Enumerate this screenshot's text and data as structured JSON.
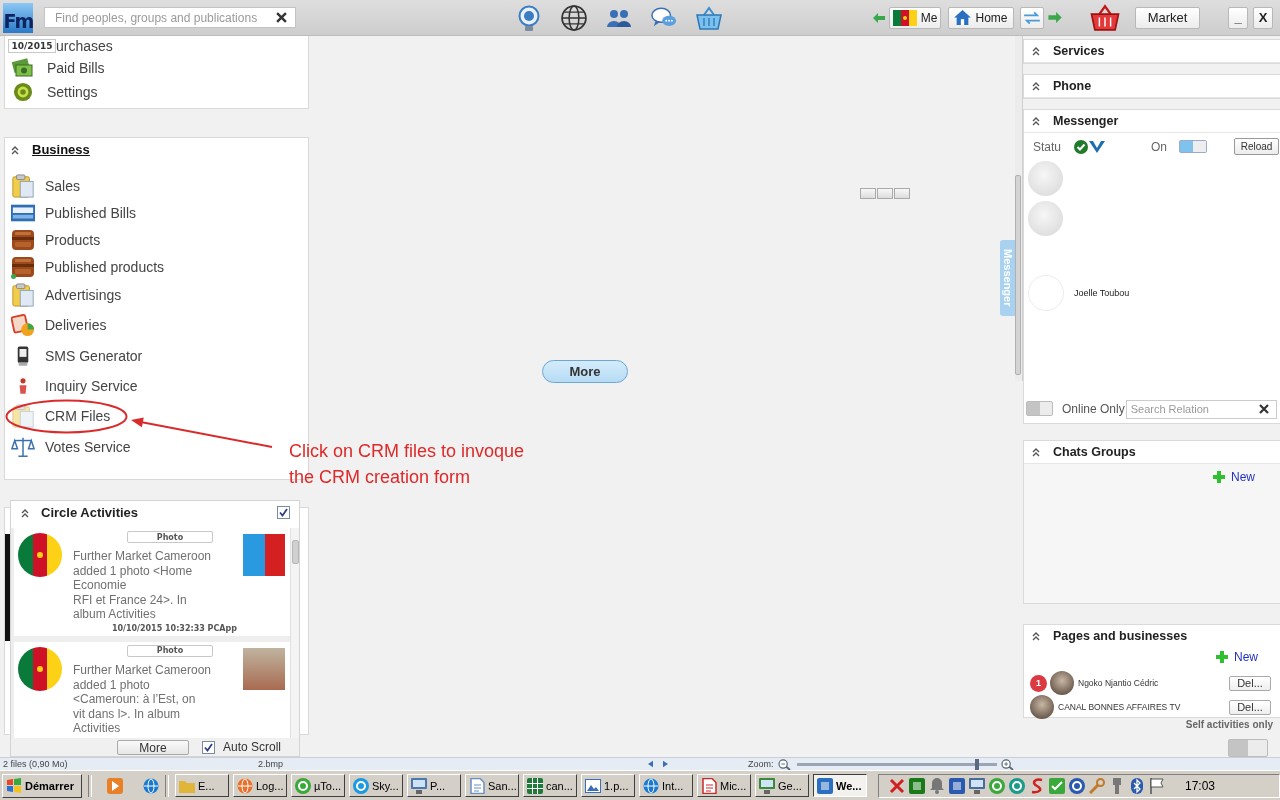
{
  "top_bar": {
    "logo": "Fm",
    "search": {
      "placeholder": "Find peoples, groups and publications"
    },
    "me": "Me",
    "home": "Home",
    "market": "Market",
    "minimize": "_",
    "close": "X"
  },
  "left_menu": {
    "date_badge": "10/2015",
    "cut_item": "urchases",
    "items": [
      {
        "label": "Paid Bills"
      },
      {
        "label": "Settings"
      }
    ]
  },
  "business": {
    "title": "Business",
    "items": [
      {
        "label": "Sales"
      },
      {
        "label": "Published Bills"
      },
      {
        "label": "Products"
      },
      {
        "label": "Published products"
      },
      {
        "label": "Advertisings"
      },
      {
        "label": "Deliveries"
      },
      {
        "label": "SMS Generator"
      },
      {
        "label": "Inquiry Service"
      },
      {
        "label": "CRM Files"
      },
      {
        "label": "Votes Service"
      }
    ]
  },
  "annotation": {
    "text": "Click on CRM files to invoque\nthe CRM creation form"
  },
  "circle_activities": {
    "title": "Circle Activities",
    "checked": true,
    "activities": [
      {
        "tag": "Photo",
        "text": "Further Market Cameroon\nadded 1 photo <Home\nEconomie\nRFI et France 24>. In\nalbum Activities",
        "time": "10/10/2015 10:32:33 PCApp"
      },
      {
        "tag": "Photo",
        "text": "Further Market Cameroon\nadded 1 photo\n<Cameroun: à l’Est, on\nvit dans l>. In album\nActivities"
      }
    ],
    "more": "More",
    "auto_scroll": {
      "label": "Auto Scroll",
      "checked": true
    }
  },
  "center": {
    "more": "More"
  },
  "right_panel": {
    "services": {
      "title": "Services"
    },
    "phone": {
      "title": "Phone"
    },
    "messenger": {
      "title": "Messenger",
      "status_label": "Statu",
      "on_label": "On",
      "on": true,
      "reload": "Reload",
      "contacts": [
        {
          "kind": "photo"
        },
        {
          "kind": "photo"
        },
        {
          "kind": "empty",
          "name": "Joelle Toubou"
        }
      ],
      "online_only": {
        "label": "Online Only",
        "on": false
      },
      "search": {
        "placeholder": "Search Relation"
      },
      "tab_label": "Messenger"
    },
    "chats_groups": {
      "title": "Chats Groups",
      "new": "New"
    },
    "pages": {
      "title": "Pages and businesses",
      "new": "New",
      "rows": [
        {
          "badge": "1",
          "name": "Ngoko Njantio Cédric",
          "action": "Del..."
        },
        {
          "name": "CANAL BONNES AFFAIRES TV",
          "action": "Del..."
        }
      ]
    },
    "self_activities": {
      "label": "Self activities only",
      "on": false
    }
  },
  "viewer_status": {
    "files": "2 files (0,90 Mo)",
    "file_name": "2.bmp",
    "zoom_label": "Zoom:",
    "zoom": {
      "level": 0.9
    }
  },
  "taskbar": {
    "start": "Démarrer",
    "tasks": [
      {
        "label": "E...",
        "selected": false
      },
      {
        "label": "Log...",
        "selected": false
      },
      {
        "label": "µTo...",
        "selected": false
      },
      {
        "label": "Sky...",
        "selected": false
      },
      {
        "label": "P...",
        "selected": false
      },
      {
        "label": "San...",
        "selected": false
      },
      {
        "label": "can...",
        "selected": false
      },
      {
        "label": "1.p...",
        "selected": false
      },
      {
        "label": "Int...",
        "selected": false
      },
      {
        "label": "Mic...",
        "selected": false
      },
      {
        "label": "Ge...",
        "selected": false
      },
      {
        "label": "We...",
        "selected": true
      }
    ],
    "clock": "17:03"
  }
}
